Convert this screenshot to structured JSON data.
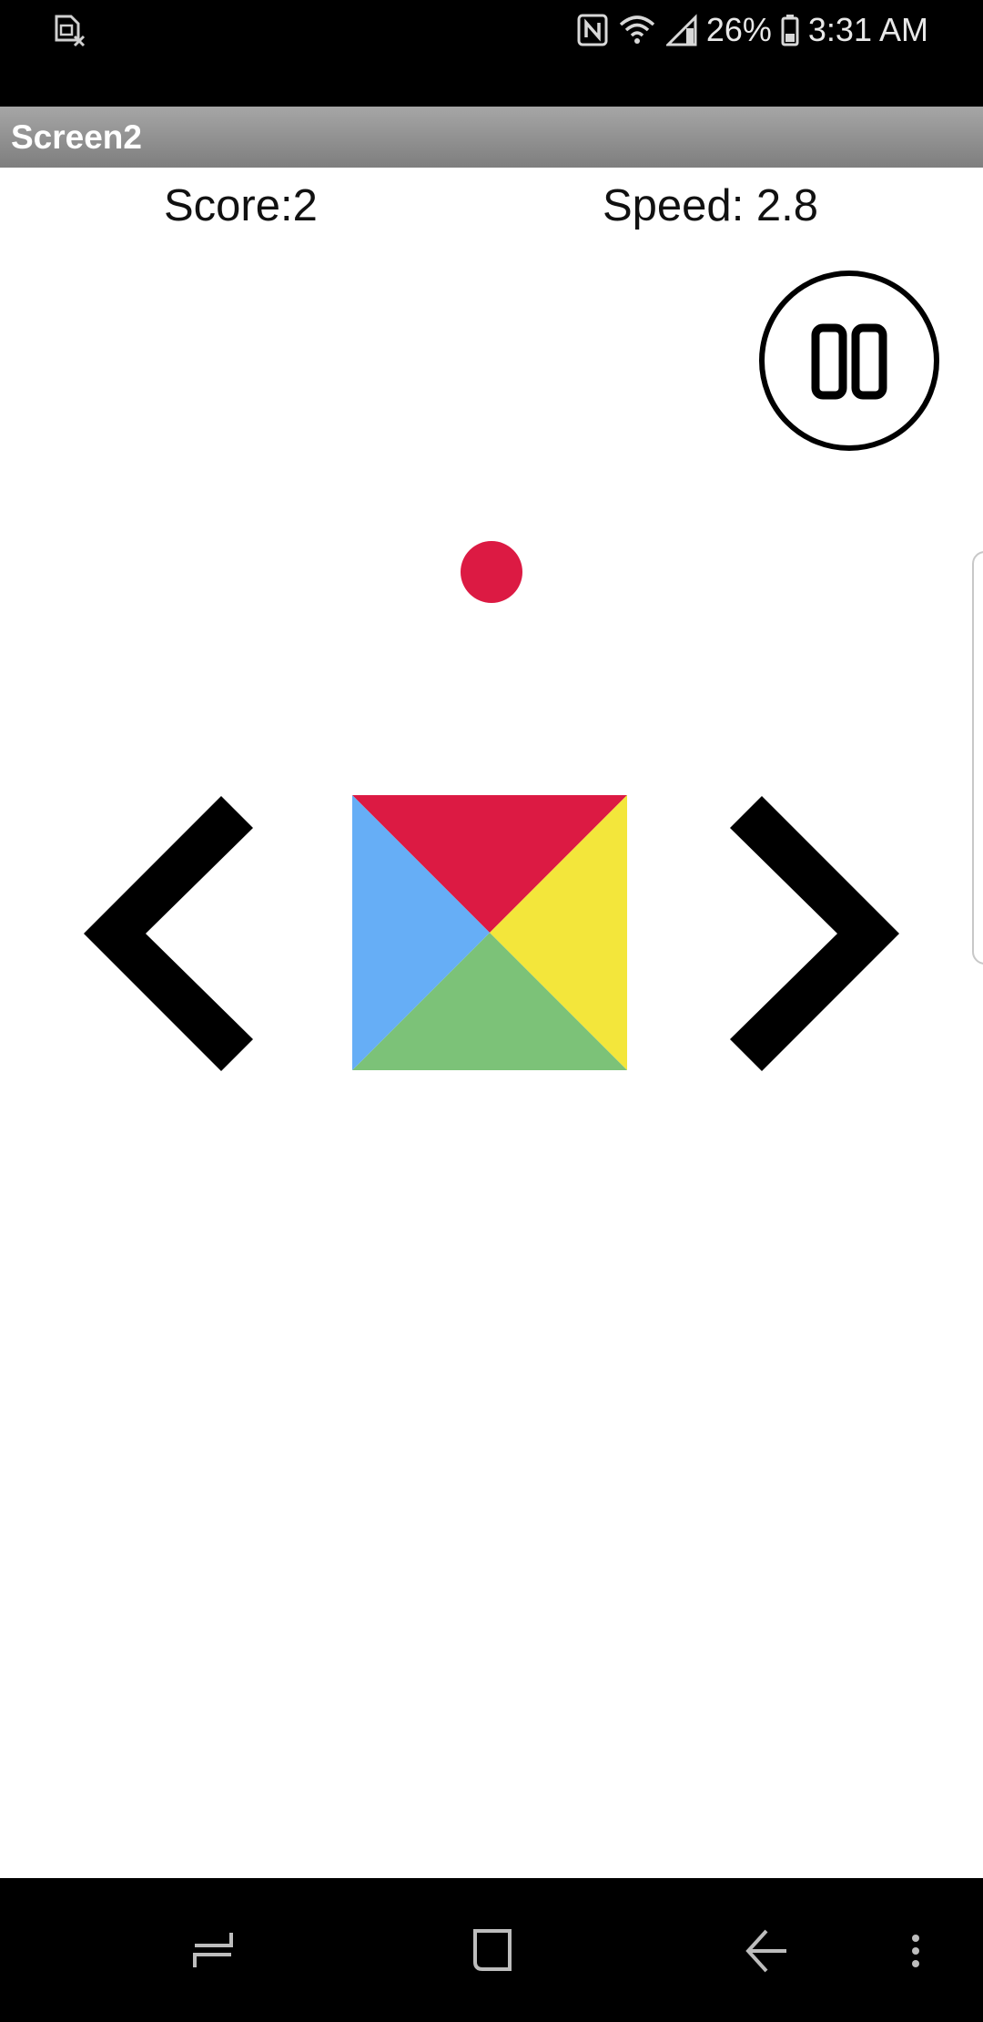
{
  "status_bar": {
    "left_icon": "sim-card-missing-icon",
    "right_icons": [
      "nfc-icon",
      "wifi-icon",
      "signal-icon"
    ],
    "battery_percent": "26%",
    "battery_icon": "battery-icon",
    "time": "3:31 AM"
  },
  "title_bar": {
    "title": "Screen2",
    "gradient_top": "#a6a6a6",
    "gradient_bottom": "#7e7e7e"
  },
  "game": {
    "score_label": "Score:2",
    "speed_label": "Speed: 2.8",
    "pause_icon": "pause-icon",
    "ball_color": "#dc1a43",
    "left_control_icon": "chevron-left-icon",
    "right_control_icon": "chevron-right-icon",
    "square_colors": {
      "top": "#dc1a43",
      "right": "#f3e63b",
      "bottom": "#7cc278",
      "left": "#66aef6"
    }
  },
  "nav_bar": {
    "buttons": [
      "recent-apps-icon",
      "home-icon",
      "back-icon",
      "more-icon"
    ]
  }
}
